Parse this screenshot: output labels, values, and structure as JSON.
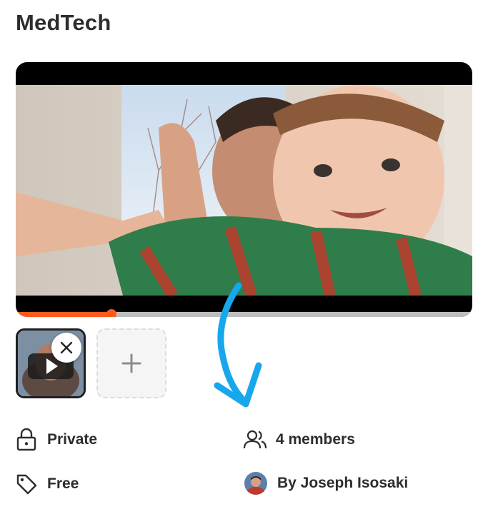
{
  "header": {
    "title": "MedTech"
  },
  "video": {
    "progress_fraction": 0.21
  },
  "thumbnails": {
    "remove_icon": "close-icon",
    "add_icon": "plus-icon"
  },
  "details": {
    "privacy": {
      "label": "Private",
      "icon": "lock-icon"
    },
    "members": {
      "label": "4 members",
      "icon": "users-icon"
    },
    "price": {
      "label": "Free",
      "icon": "tag-icon"
    },
    "author": {
      "label": "By Joseph Isosaki",
      "icon": "avatar"
    }
  },
  "colors": {
    "accent": "#ff5a1f",
    "annotation_arrow": "#17a7ec",
    "text": "#2d2d2d"
  }
}
